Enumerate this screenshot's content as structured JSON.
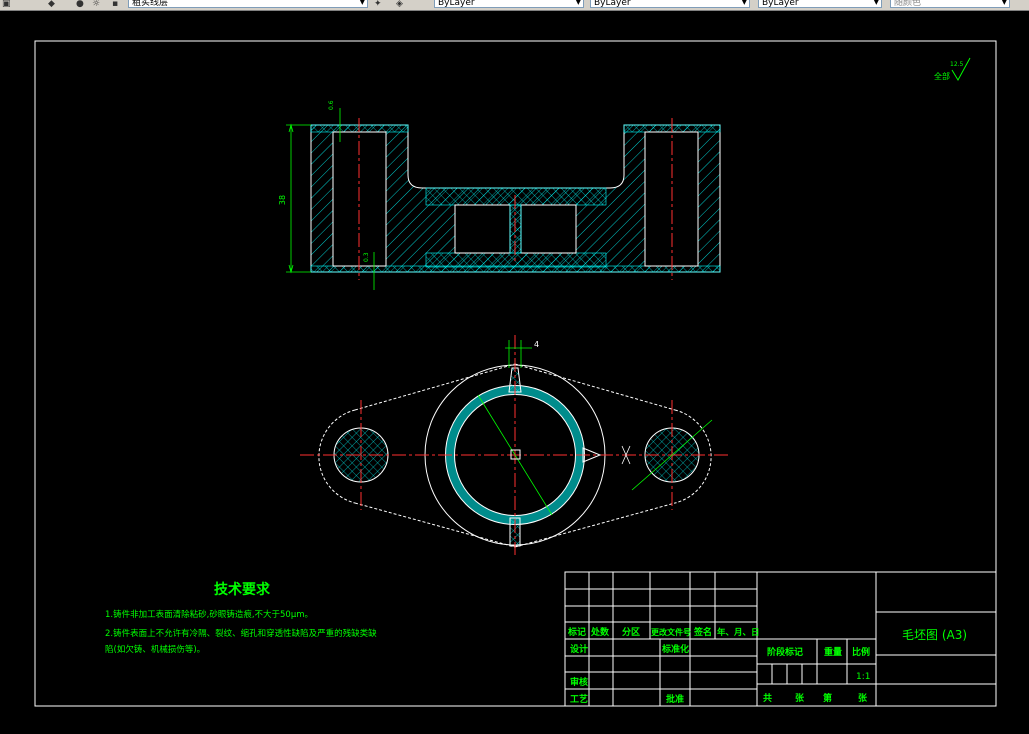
{
  "toolbar": {
    "layer_name": "粗实线层",
    "color_control": "ByLayer",
    "linetype_control": "ByLayer",
    "lineweight_control": "ByLayer",
    "plotstyle_control": "随颜色"
  },
  "drawing": {
    "roughness_note": "全部",
    "roughness_value": "12.5",
    "dimensions": {
      "height": "38",
      "top_tol": "0.6",
      "bottom_tol": "0.3",
      "slot_width": "4"
    },
    "technical_requirements": {
      "title": "技术要求",
      "items": [
        "1.铸件非加工表面清除粘砂,砂眼铸造痕,不大于50μm。",
        "2.铸件表面上不允许有冷隔、裂纹、缩孔和穿透性缺陷及严重的残缺类缺",
        "陷(如欠铸、机械损伤等)。"
      ]
    },
    "title_block": {
      "row_labels": [
        "标记",
        "处数",
        "分区",
        "更改文件号",
        "签名",
        "年、月、日"
      ],
      "design": "设计",
      "standardize": "标准化",
      "review": "审核",
      "process": "工艺",
      "approve": "批准",
      "stage_mark": "阶段标记",
      "weight": "重量",
      "scale": "比例",
      "scale_value": "1:1",
      "total_label": "共",
      "sheet_unit": "张",
      "page_label": "第",
      "page_unit": "张",
      "drawing_name": "毛坯图 (A3)"
    }
  }
}
